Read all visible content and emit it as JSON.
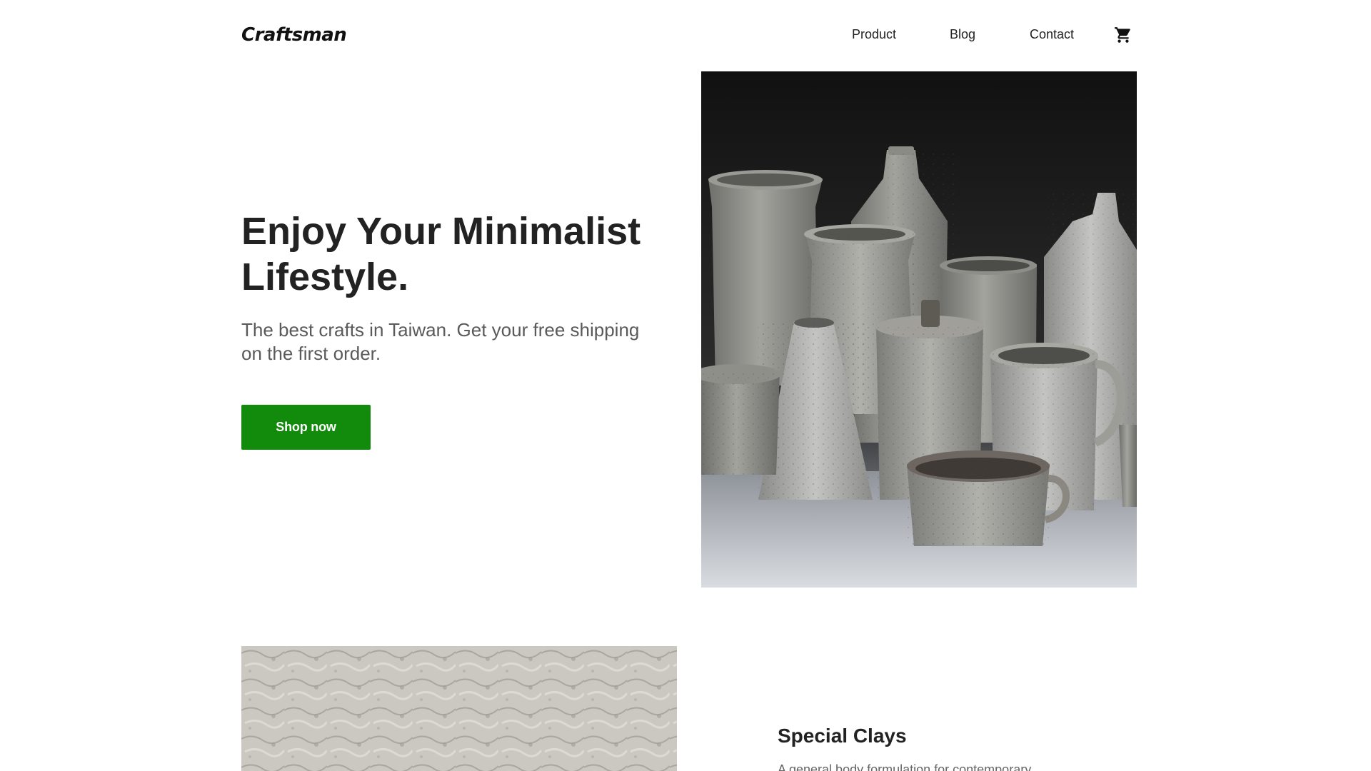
{
  "header": {
    "logo": "Craftsman",
    "nav": {
      "product": "Product",
      "blog": "Blog",
      "contact": "Contact"
    },
    "cart_icon": "shopping-cart-icon"
  },
  "hero": {
    "title": "Enjoy Your Minimalist Lifestyle.",
    "subtitle": "The best crafts in Taiwan. Get your free shipping on the first order.",
    "cta_label": "Shop now",
    "cta_color": "#128a0c"
  },
  "feature": {
    "title": "Special Clays",
    "description": "A general body formulation for contemporary"
  }
}
